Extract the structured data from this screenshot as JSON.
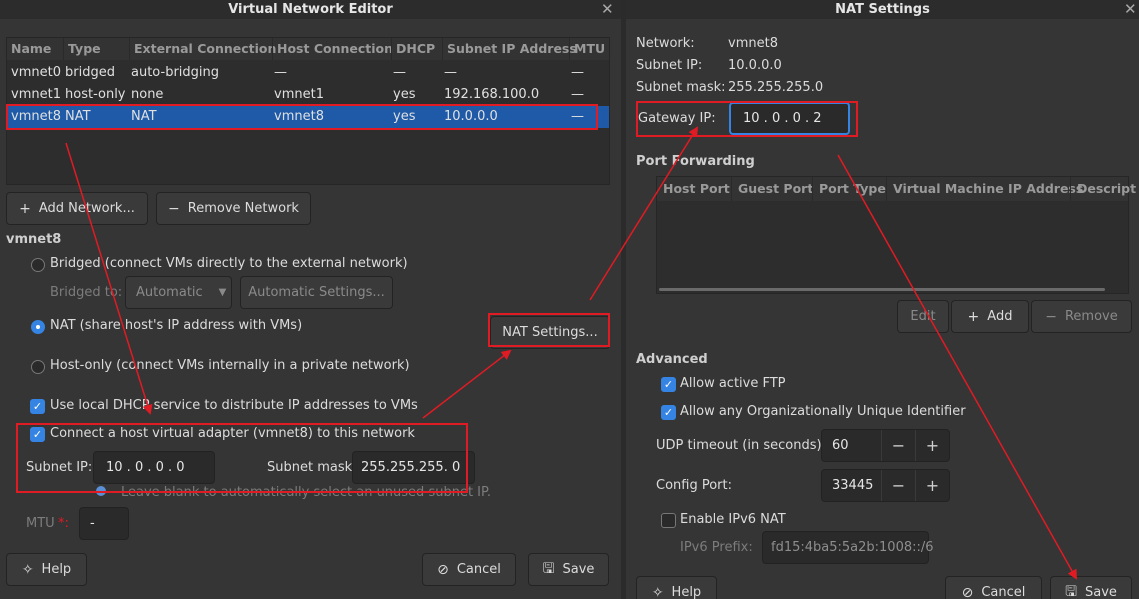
{
  "left": {
    "title": "Virtual Network Editor",
    "columns": [
      "Name",
      "Type",
      "External Connection",
      "Host Connection",
      "DHCP",
      "Subnet IP Address",
      "MTU"
    ],
    "rows": [
      [
        "vmnet0",
        "bridged",
        "auto-bridging",
        "—",
        "—",
        "—",
        "—"
      ],
      [
        "vmnet1",
        "host-only",
        "none",
        "vmnet1",
        "yes",
        "192.168.100.0",
        "—"
      ],
      [
        "vmnet8",
        "NAT",
        "NAT",
        "vmnet8",
        "yes",
        "10.0.0.0",
        "—"
      ]
    ],
    "selected_row": 2,
    "add_network": "Add Network...",
    "remove_network": "Remove Network",
    "section": "vmnet8",
    "bridged_label": "Bridged (connect VMs directly to the external network)",
    "bridged_to_label": "Bridged to:",
    "bridged_to_value": "Automatic",
    "automatic_settings": "Automatic Settings...",
    "nat_label": "NAT (share host's IP address with VMs)",
    "nat_settings": "NAT Settings...",
    "hostonly_label": "Host-only (connect VMs internally in a private network)",
    "dhcp_label": "Use local DHCP service to distribute IP addresses to VMs",
    "connect_label": "Connect a host virtual adapter (vmnet8) to this network",
    "subnet_ip_label": "Subnet IP:",
    "subnet_ip_value": "10 . 0 . 0 . 0",
    "subnet_mask_label": "Subnet mask:",
    "subnet_mask_value": "255.255.255. 0",
    "leave_blank": "Leave blank to automatically select an unused subnet IP.",
    "mtu_label": "MTU",
    "mtu_required": "*:",
    "mtu_value": "-",
    "help": "Help",
    "cancel": "Cancel",
    "save": "Save"
  },
  "right": {
    "title": "NAT Settings",
    "network_label": "Network:",
    "network_value": "vmnet8",
    "subnet_ip_label": "Subnet IP:",
    "subnet_ip_value": "10.0.0.0",
    "subnet_mask_label": "Subnet mask:",
    "subnet_mask_value": "255.255.255.0",
    "gateway_label": "Gateway IP:",
    "gateway_value": "10 . 0 . 0 . 2",
    "port_forwarding": "Port Forwarding",
    "pf_columns": [
      "Host Port",
      "Guest Port",
      "Port Type",
      "Virtual Machine IP Address",
      "Descript"
    ],
    "edit": "Edit",
    "add": "Add",
    "remove": "Remove",
    "advanced": "Advanced",
    "allow_ftp": "Allow active FTP",
    "allow_oui": "Allow any Organizationally Unique Identifier",
    "udp_label": "UDP timeout (in seconds):",
    "udp_value": "60",
    "config_port_label": "Config Port:",
    "config_port_value": "33445",
    "ipv6_label": "Enable IPv6 NAT",
    "ipv6_prefix_label": "IPv6 Prefix:",
    "ipv6_prefix_value": "fd15:4ba5:5a2b:1008::/6",
    "help": "Help",
    "cancel": "Cancel",
    "save": "Save"
  },
  "colors": {
    "accent": "#3584e4",
    "selection": "#1e5aa8",
    "annotation": "#e01b24"
  }
}
